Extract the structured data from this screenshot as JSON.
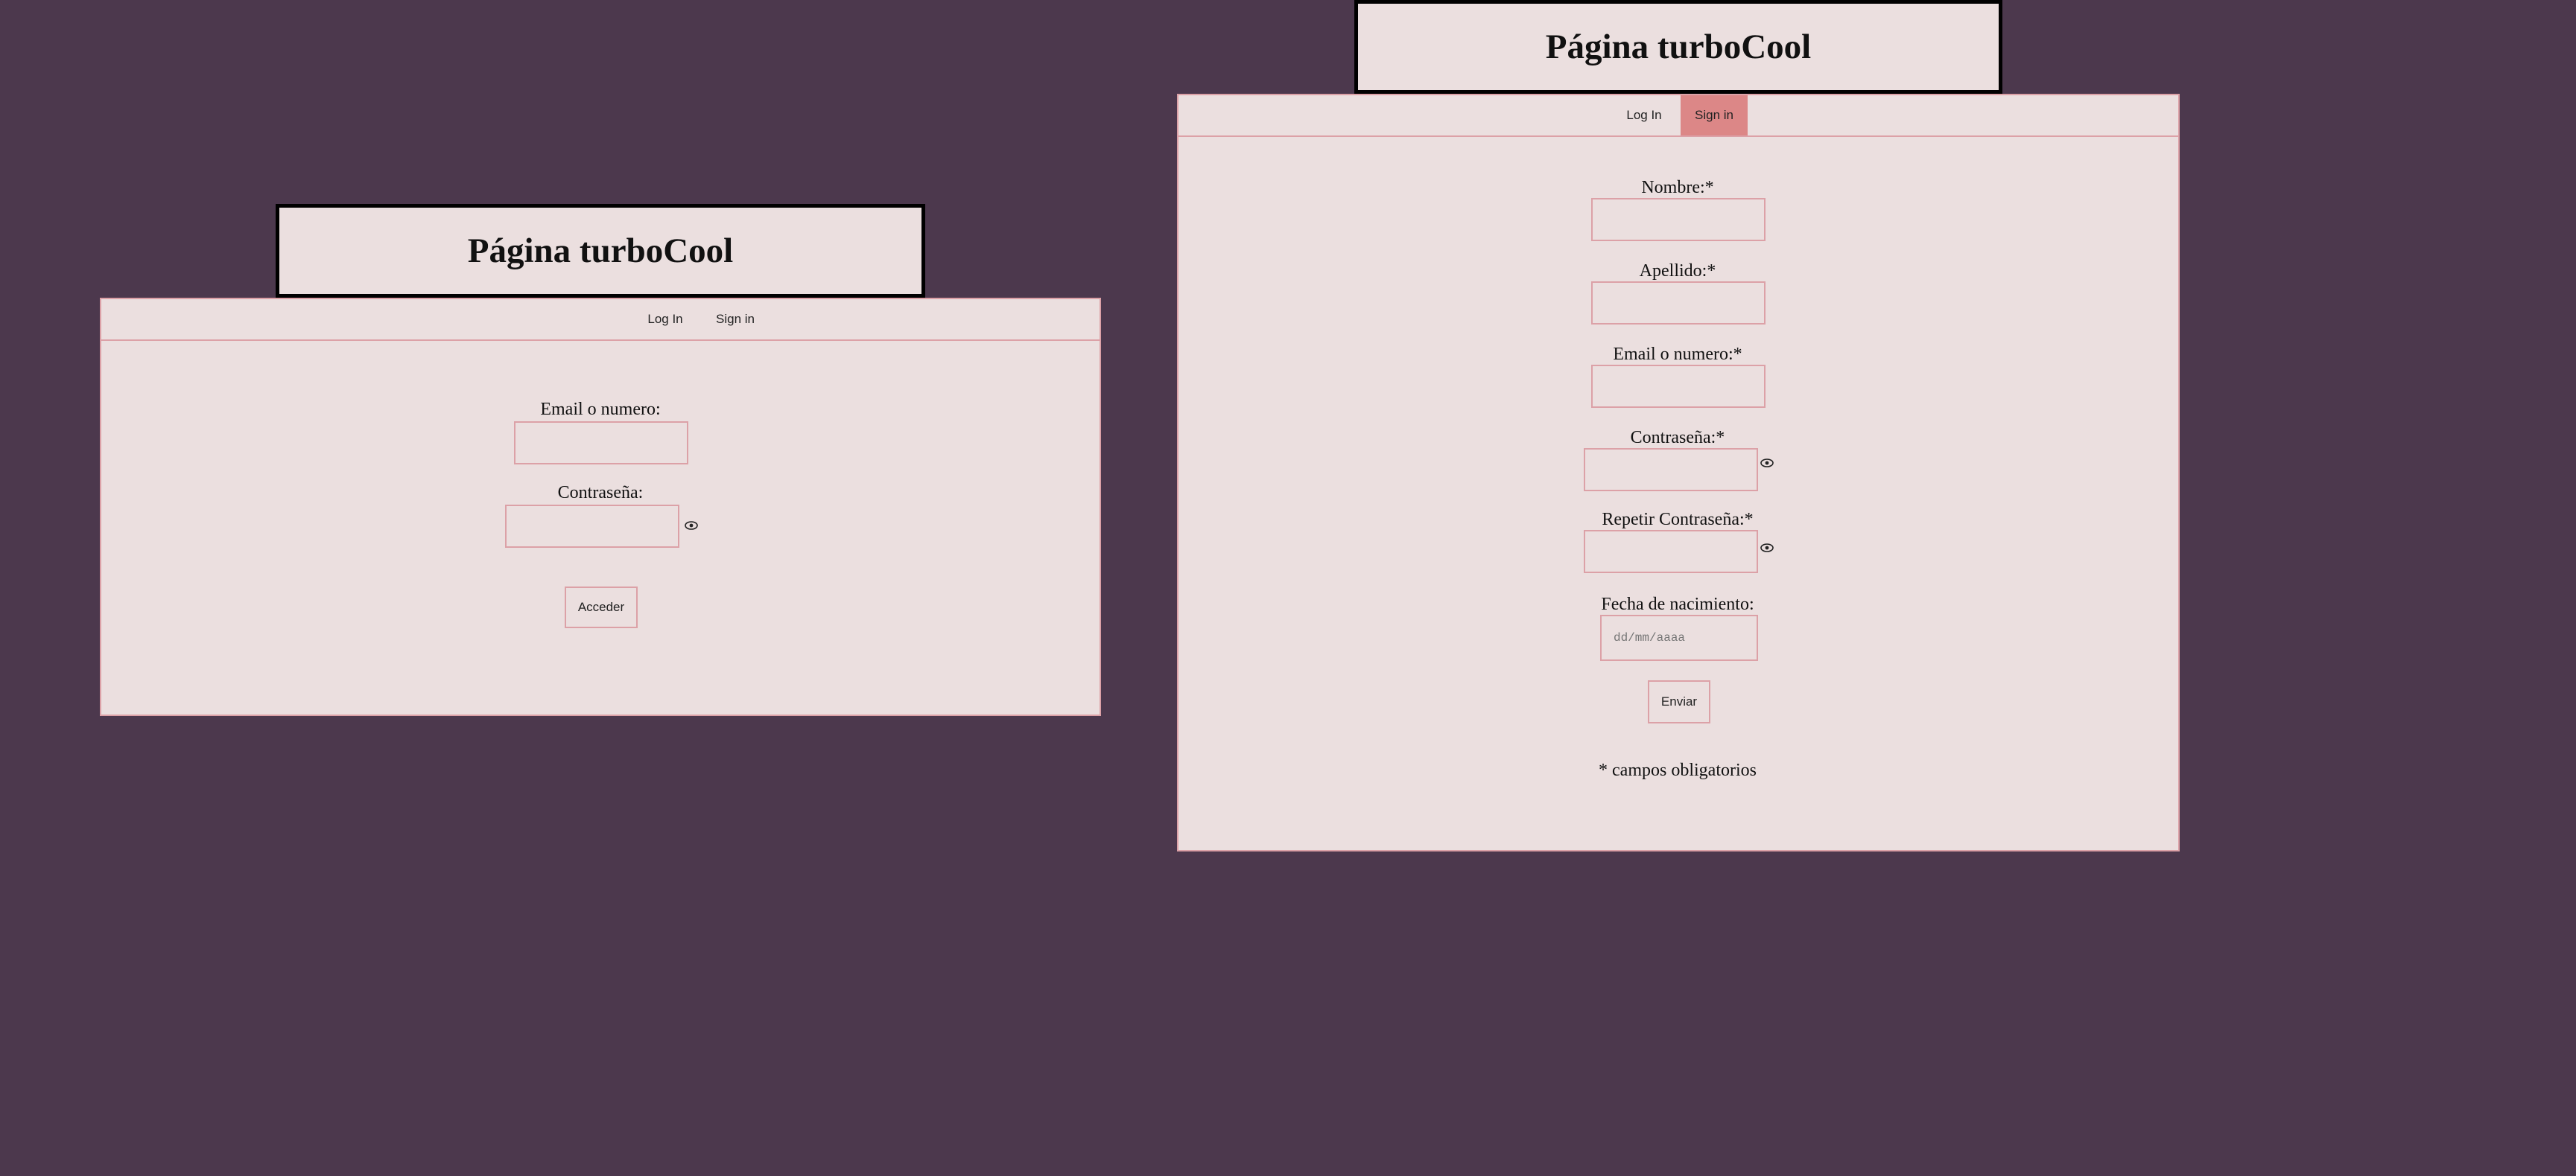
{
  "login_view": {
    "title": "Página turboCool",
    "nav": {
      "login": "Log In",
      "signin": "Sign in",
      "active": "login"
    },
    "form": {
      "email_label": "Email o numero:",
      "email_value": "",
      "password_label": "Contraseña:",
      "password_value": "",
      "submit_label": "Acceder"
    }
  },
  "signup_view": {
    "title": "Página turboCool",
    "nav": {
      "login": "Log In",
      "signin": "Sign in",
      "active": "signin"
    },
    "form": {
      "nombre_label": "Nombre:*",
      "apellido_label": "Apellido:*",
      "email_label": "Email o numero:*",
      "password_label": "Contraseña:*",
      "repeat_password_label": "Repetir Contraseña:*",
      "birthdate_label": "Fecha de nacimiento:",
      "birthdate_placeholder": "dd/mm/aaaa",
      "submit_label": "Enviar",
      "required_note": "* campos obligatorios"
    }
  },
  "colors": {
    "background": "#4c384d",
    "panel": "#ebdfdf",
    "border": "#dca1a7",
    "nav_active": "#dc8787"
  },
  "icons": {
    "password_toggle": "eye-icon"
  }
}
